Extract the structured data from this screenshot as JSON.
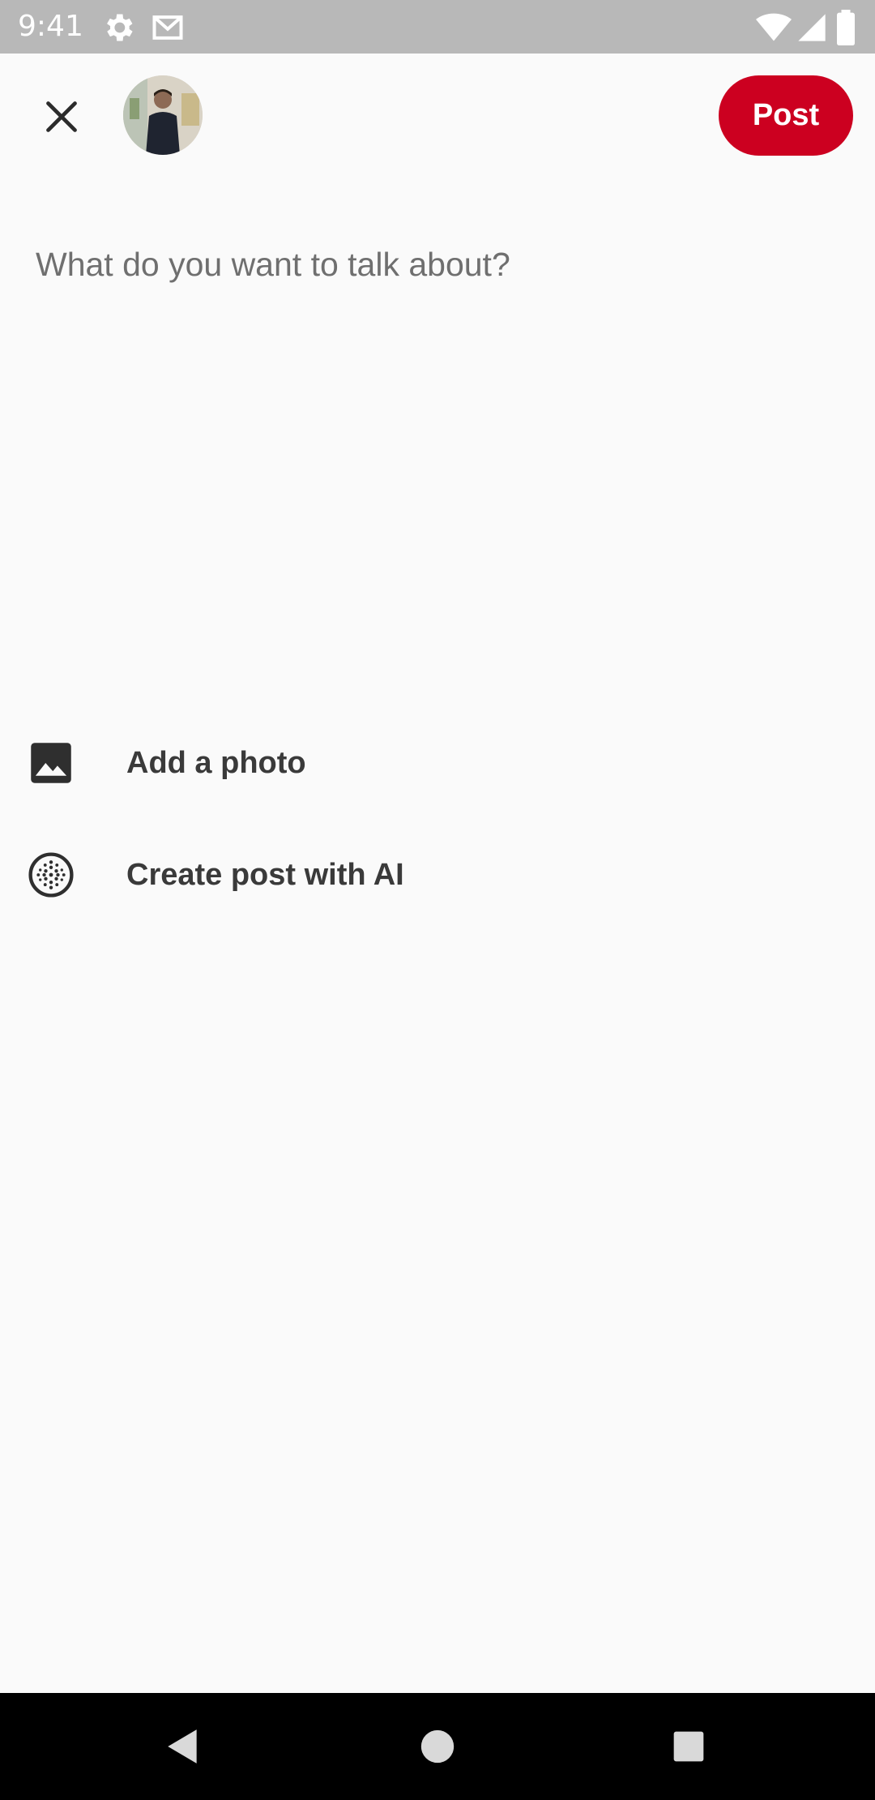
{
  "status_bar": {
    "time": "9:41",
    "icons": [
      "gear-icon",
      "gmail-icon",
      "wifi-icon",
      "signal-icon",
      "battery-icon"
    ]
  },
  "header": {
    "close_icon": "close-icon",
    "post_label": "Post",
    "accent_color": "#cc0020"
  },
  "composer": {
    "placeholder": "What do you want to talk about?",
    "value": ""
  },
  "actions": [
    {
      "icon": "image-icon",
      "label": "Add a photo"
    },
    {
      "icon": "ai-sparkle-icon",
      "label": "Create post with AI"
    }
  ],
  "nav_bar": {
    "icons": [
      "back-icon",
      "home-icon",
      "recents-icon"
    ]
  }
}
